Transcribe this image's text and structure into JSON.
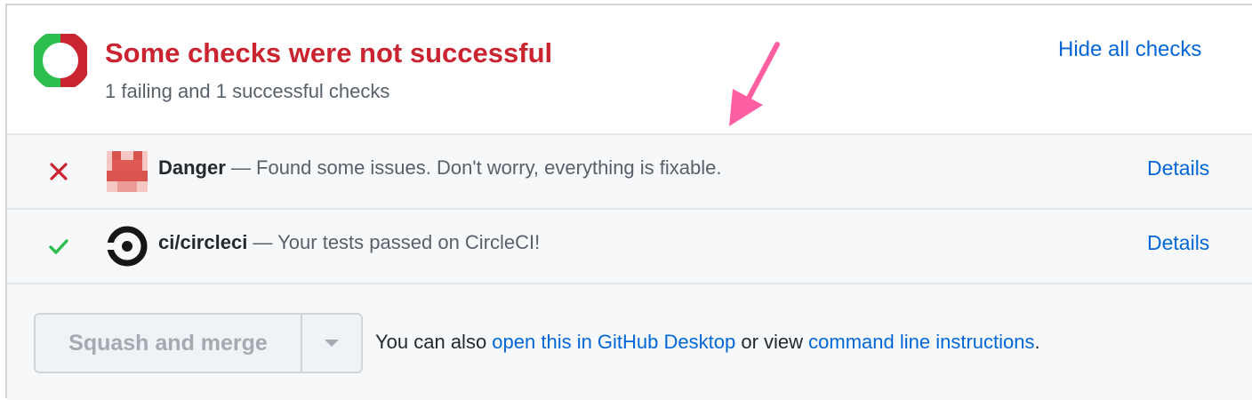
{
  "header": {
    "title": "Some checks were not successful",
    "subtitle": "1 failing and 1 successful checks",
    "hide_link": "Hide all checks",
    "status_icon": "partial-failure-ring-icon"
  },
  "checks": [
    {
      "state": "failure",
      "state_icon": "x-icon",
      "avatar": "danger-app-avatar",
      "name": "Danger",
      "description": " — Found some issues. Don't worry, everything is fixable.",
      "details": "Details"
    },
    {
      "state": "success",
      "state_icon": "check-icon",
      "avatar": "circleci-logo-icon",
      "name": "ci/circleci",
      "description": " — Your tests passed on CircleCI!",
      "details": "Details"
    }
  ],
  "merge": {
    "button_label": "Squash and merge",
    "dropdown_icon": "chevron-down-icon",
    "prefix": "You can also ",
    "desktop_link": "open this in GitHub Desktop",
    "middle": " or view ",
    "cli_link": "command line instructions",
    "suffix": "."
  },
  "colors": {
    "failure": "#cb2431",
    "success": "#2cbe4e",
    "link": "#0366d6",
    "annotation": "#ff5fa2"
  }
}
